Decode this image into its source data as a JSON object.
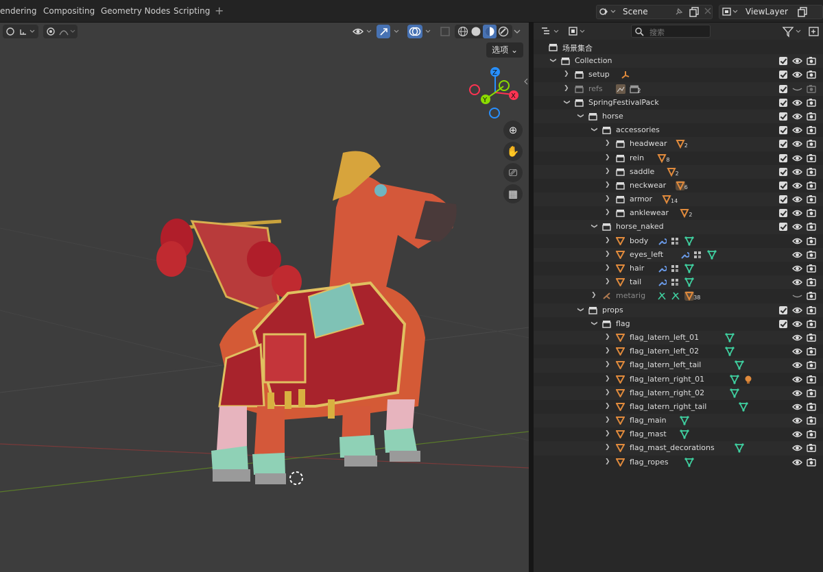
{
  "workspace_tabs": [
    "endering",
    "Compositing",
    "Geometry Nodes",
    "Scripting"
  ],
  "scene": {
    "label": "Scene"
  },
  "view_layer": {
    "label": "ViewLayer"
  },
  "viewport": {
    "options_label": "选项"
  },
  "gizmo": {
    "z": "Z",
    "y": "Y",
    "x": "X"
  },
  "outliner": {
    "search_placeholder": "搜索",
    "root_label": "场景集合",
    "rows": [
      {
        "name": "collection",
        "label": "Collection",
        "depth": 0,
        "type": "collection",
        "expanded": true,
        "check": true,
        "eye": true
      },
      {
        "name": "setup",
        "label": "setup",
        "depth": 1,
        "type": "collection",
        "expanded": false,
        "check": true,
        "eye": true,
        "extras": [
          "armature"
        ]
      },
      {
        "name": "refs",
        "label": "refs",
        "depth": 1,
        "type": "collection",
        "expanded": false,
        "check": true,
        "eye": false,
        "dim": true,
        "extras": [
          "image"
        ],
        "badge": "2"
      },
      {
        "name": "springfestivalpack",
        "label": "SpringFestivalPack",
        "depth": 1,
        "type": "collection",
        "expanded": true,
        "check": true,
        "eye": true
      },
      {
        "name": "horse",
        "label": "horse",
        "depth": 2,
        "type": "collection",
        "expanded": true,
        "check": true,
        "eye": true
      },
      {
        "name": "accessories",
        "label": "accessories",
        "depth": 3,
        "type": "collection",
        "expanded": true,
        "check": true,
        "eye": true
      },
      {
        "name": "headwear",
        "label": "headwear",
        "depth": 4,
        "type": "collection",
        "expanded": false,
        "check": true,
        "eye": true,
        "extras": [
          "mesh"
        ],
        "badge": "2"
      },
      {
        "name": "rein",
        "label": "rein",
        "depth": 4,
        "type": "collection",
        "expanded": false,
        "check": true,
        "eye": true,
        "extras": [
          "mesh"
        ],
        "badge": "8"
      },
      {
        "name": "saddle",
        "label": "saddle",
        "depth": 4,
        "type": "collection",
        "expanded": false,
        "check": true,
        "eye": true,
        "extras": [
          "mesh"
        ],
        "badge": "2"
      },
      {
        "name": "neckwear",
        "label": "neckwear",
        "depth": 4,
        "type": "collection",
        "expanded": false,
        "check": true,
        "eye": true,
        "extras": [
          "mesh-hl"
        ],
        "badge": "6"
      },
      {
        "name": "armor",
        "label": "armor",
        "depth": 4,
        "type": "collection",
        "expanded": false,
        "check": true,
        "eye": true,
        "extras": [
          "mesh"
        ],
        "badge": "14"
      },
      {
        "name": "anklewear",
        "label": "anklewear",
        "depth": 4,
        "type": "collection",
        "expanded": false,
        "check": true,
        "eye": true,
        "extras": [
          "mesh"
        ],
        "badge": "2"
      },
      {
        "name": "horse_naked",
        "label": "horse_naked",
        "depth": 3,
        "type": "collection",
        "expanded": true,
        "check": true,
        "eye": true
      },
      {
        "name": "body",
        "label": "body",
        "depth": 4,
        "type": "object",
        "expanded": false,
        "check": false,
        "eye": true,
        "extras": [
          "wrench",
          "modifier",
          "vgroup"
        ]
      },
      {
        "name": "eyes_left",
        "label": "eyes_left",
        "depth": 4,
        "type": "object",
        "expanded": false,
        "check": false,
        "eye": true,
        "extras": [
          "wrench",
          "modifier",
          "vgroup"
        ]
      },
      {
        "name": "hair",
        "label": "hair",
        "depth": 4,
        "type": "object",
        "expanded": false,
        "check": false,
        "eye": true,
        "extras": [
          "wrench",
          "modifier",
          "vgroup"
        ]
      },
      {
        "name": "tail",
        "label": "tail",
        "depth": 4,
        "type": "object",
        "expanded": false,
        "check": false,
        "eye": true,
        "extras": [
          "wrench",
          "modifier",
          "vgroup"
        ]
      },
      {
        "name": "metarig",
        "label": "metarig",
        "depth": 3,
        "type": "armature",
        "expanded": false,
        "check": false,
        "eye": false,
        "dim": true,
        "extras": [
          "pose",
          "pose2",
          "mesh-hl"
        ],
        "badge": "38"
      },
      {
        "name": "props",
        "label": "props",
        "depth": 2,
        "type": "collection",
        "expanded": true,
        "check": true,
        "eye": true
      },
      {
        "name": "flag",
        "label": "flag",
        "depth": 3,
        "type": "collection",
        "expanded": true,
        "check": true,
        "eye": true
      },
      {
        "name": "flag_latern_left_01",
        "label": "flag_latern_left_01",
        "depth": 4,
        "type": "object",
        "expanded": false,
        "check": false,
        "eye": true,
        "extras": [
          "vgroup"
        ]
      },
      {
        "name": "flag_latern_left_02",
        "label": "flag_latern_left_02",
        "depth": 4,
        "type": "object",
        "expanded": false,
        "check": false,
        "eye": true,
        "extras": [
          "vgroup"
        ]
      },
      {
        "name": "flag_latern_left_tail",
        "label": "flag_latern_left_tail",
        "depth": 4,
        "type": "object",
        "expanded": false,
        "check": false,
        "eye": true,
        "extras": [
          "vgroup"
        ]
      },
      {
        "name": "flag_latern_right_01",
        "label": "flag_latern_right_01",
        "depth": 4,
        "type": "object",
        "expanded": false,
        "check": false,
        "eye": true,
        "extras": [
          "vgroup",
          "light"
        ]
      },
      {
        "name": "flag_latern_right_02",
        "label": "flag_latern_right_02",
        "depth": 4,
        "type": "object",
        "expanded": false,
        "check": false,
        "eye": true,
        "extras": [
          "vgroup"
        ]
      },
      {
        "name": "flag_latern_right_tail",
        "label": "flag_latern_right_tail",
        "depth": 4,
        "type": "object",
        "expanded": false,
        "check": false,
        "eye": true,
        "extras": [
          "vgroup"
        ]
      },
      {
        "name": "flag_main",
        "label": "flag_main",
        "depth": 4,
        "type": "object",
        "expanded": false,
        "check": false,
        "eye": true,
        "extras": [
          "vgroup"
        ]
      },
      {
        "name": "flag_mast",
        "label": "flag_mast",
        "depth": 4,
        "type": "object",
        "expanded": false,
        "check": false,
        "eye": true,
        "extras": [
          "vgroup"
        ]
      },
      {
        "name": "flag_mast_decorations",
        "label": "flag_mast_decorations",
        "depth": 4,
        "type": "object",
        "expanded": false,
        "check": false,
        "eye": true,
        "extras": [
          "vgroup"
        ]
      },
      {
        "name": "flag_ropes",
        "label": "flag_ropes",
        "depth": 4,
        "type": "object",
        "expanded": false,
        "check": false,
        "eye": true,
        "extras": [
          "vgroup"
        ]
      }
    ]
  },
  "colors": {
    "accent_blue": "#4772b3",
    "object_orange": "#e08a3c",
    "vgroup_green": "#3fd0a0",
    "wrench_blue": "#6a9ae8",
    "x_red": "#ff3352",
    "y_green": "#8bdc00",
    "z_blue": "#2890ff"
  }
}
